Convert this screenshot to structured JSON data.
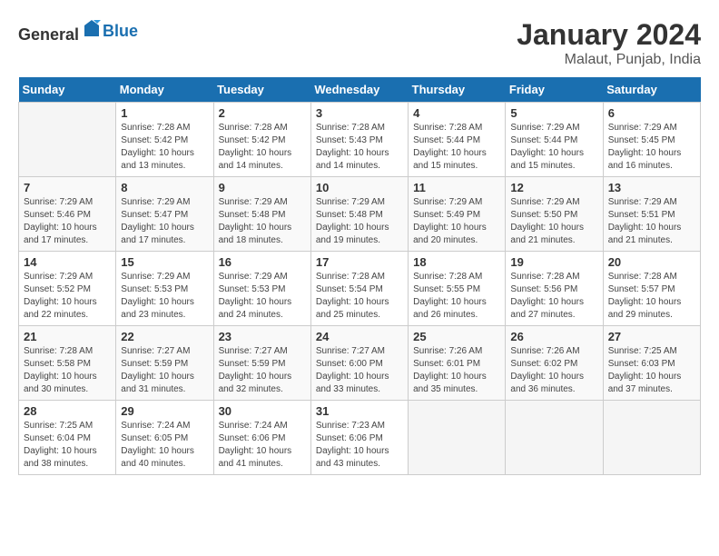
{
  "header": {
    "logo_general": "General",
    "logo_blue": "Blue",
    "month_title": "January 2024",
    "location": "Malaut, Punjab, India"
  },
  "days_of_week": [
    "Sunday",
    "Monday",
    "Tuesday",
    "Wednesday",
    "Thursday",
    "Friday",
    "Saturday"
  ],
  "weeks": [
    [
      {
        "day": "",
        "empty": true
      },
      {
        "day": "1",
        "sunrise": "7:28 AM",
        "sunset": "5:42 PM",
        "daylight": "10 hours and 13 minutes."
      },
      {
        "day": "2",
        "sunrise": "7:28 AM",
        "sunset": "5:42 PM",
        "daylight": "10 hours and 14 minutes."
      },
      {
        "day": "3",
        "sunrise": "7:28 AM",
        "sunset": "5:43 PM",
        "daylight": "10 hours and 14 minutes."
      },
      {
        "day": "4",
        "sunrise": "7:28 AM",
        "sunset": "5:44 PM",
        "daylight": "10 hours and 15 minutes."
      },
      {
        "day": "5",
        "sunrise": "7:29 AM",
        "sunset": "5:44 PM",
        "daylight": "10 hours and 15 minutes."
      },
      {
        "day": "6",
        "sunrise": "7:29 AM",
        "sunset": "5:45 PM",
        "daylight": "10 hours and 16 minutes."
      }
    ],
    [
      {
        "day": "7",
        "sunrise": "7:29 AM",
        "sunset": "5:46 PM",
        "daylight": "10 hours and 17 minutes."
      },
      {
        "day": "8",
        "sunrise": "7:29 AM",
        "sunset": "5:47 PM",
        "daylight": "10 hours and 17 minutes."
      },
      {
        "day": "9",
        "sunrise": "7:29 AM",
        "sunset": "5:48 PM",
        "daylight": "10 hours and 18 minutes."
      },
      {
        "day": "10",
        "sunrise": "7:29 AM",
        "sunset": "5:48 PM",
        "daylight": "10 hours and 19 minutes."
      },
      {
        "day": "11",
        "sunrise": "7:29 AM",
        "sunset": "5:49 PM",
        "daylight": "10 hours and 20 minutes."
      },
      {
        "day": "12",
        "sunrise": "7:29 AM",
        "sunset": "5:50 PM",
        "daylight": "10 hours and 21 minutes."
      },
      {
        "day": "13",
        "sunrise": "7:29 AM",
        "sunset": "5:51 PM",
        "daylight": "10 hours and 21 minutes."
      }
    ],
    [
      {
        "day": "14",
        "sunrise": "7:29 AM",
        "sunset": "5:52 PM",
        "daylight": "10 hours and 22 minutes."
      },
      {
        "day": "15",
        "sunrise": "7:29 AM",
        "sunset": "5:53 PM",
        "daylight": "10 hours and 23 minutes."
      },
      {
        "day": "16",
        "sunrise": "7:29 AM",
        "sunset": "5:53 PM",
        "daylight": "10 hours and 24 minutes."
      },
      {
        "day": "17",
        "sunrise": "7:28 AM",
        "sunset": "5:54 PM",
        "daylight": "10 hours and 25 minutes."
      },
      {
        "day": "18",
        "sunrise": "7:28 AM",
        "sunset": "5:55 PM",
        "daylight": "10 hours and 26 minutes."
      },
      {
        "day": "19",
        "sunrise": "7:28 AM",
        "sunset": "5:56 PM",
        "daylight": "10 hours and 27 minutes."
      },
      {
        "day": "20",
        "sunrise": "7:28 AM",
        "sunset": "5:57 PM",
        "daylight": "10 hours and 29 minutes."
      }
    ],
    [
      {
        "day": "21",
        "sunrise": "7:28 AM",
        "sunset": "5:58 PM",
        "daylight": "10 hours and 30 minutes."
      },
      {
        "day": "22",
        "sunrise": "7:27 AM",
        "sunset": "5:59 PM",
        "daylight": "10 hours and 31 minutes."
      },
      {
        "day": "23",
        "sunrise": "7:27 AM",
        "sunset": "5:59 PM",
        "daylight": "10 hours and 32 minutes."
      },
      {
        "day": "24",
        "sunrise": "7:27 AM",
        "sunset": "6:00 PM",
        "daylight": "10 hours and 33 minutes."
      },
      {
        "day": "25",
        "sunrise": "7:26 AM",
        "sunset": "6:01 PM",
        "daylight": "10 hours and 35 minutes."
      },
      {
        "day": "26",
        "sunrise": "7:26 AM",
        "sunset": "6:02 PM",
        "daylight": "10 hours and 36 minutes."
      },
      {
        "day": "27",
        "sunrise": "7:25 AM",
        "sunset": "6:03 PM",
        "daylight": "10 hours and 37 minutes."
      }
    ],
    [
      {
        "day": "28",
        "sunrise": "7:25 AM",
        "sunset": "6:04 PM",
        "daylight": "10 hours and 38 minutes."
      },
      {
        "day": "29",
        "sunrise": "7:24 AM",
        "sunset": "6:05 PM",
        "daylight": "10 hours and 40 minutes."
      },
      {
        "day": "30",
        "sunrise": "7:24 AM",
        "sunset": "6:06 PM",
        "daylight": "10 hours and 41 minutes."
      },
      {
        "day": "31",
        "sunrise": "7:23 AM",
        "sunset": "6:06 PM",
        "daylight": "10 hours and 43 minutes."
      },
      {
        "day": "",
        "empty": true
      },
      {
        "day": "",
        "empty": true
      },
      {
        "day": "",
        "empty": true
      }
    ]
  ],
  "labels": {
    "sunrise": "Sunrise:",
    "sunset": "Sunset:",
    "daylight": "Daylight:"
  }
}
